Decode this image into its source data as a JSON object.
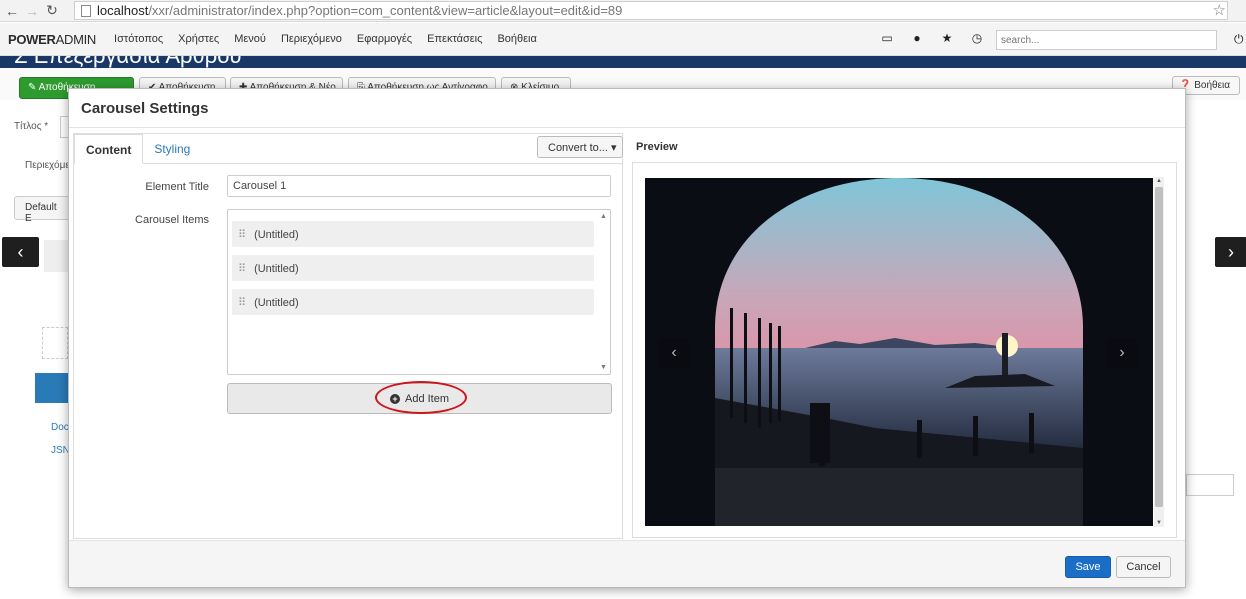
{
  "browser": {
    "url_host": "localhost",
    "url_path": "/xxr/administrator/index.php?option=com_content&view=article&layout=edit&id=89"
  },
  "topbar": {
    "brand_bold": "POWER",
    "brand_light": "ADMIN",
    "menu": [
      "Ιστότοπος",
      "Χρήστες",
      "Μενού",
      "Περιεχόμενο",
      "Εφαρμογές",
      "Επεκτάσεις",
      "Βοήθεια"
    ],
    "search_placeholder": "search..."
  },
  "page": {
    "title": "Σ Επεξεργασία Άρθρου",
    "toolbar": {
      "save": "Αποθήκευση",
      "save_close": "Αποθήκευση",
      "save_new": "Αποθήκευση & Νέο",
      "save_copy": "Αποθήκευση ως Αντίγραφο",
      "close": "Κλείσιμο",
      "help": "Βοήθεια"
    },
    "bg": {
      "title_label": "Τίτλος *",
      "content_tab": "Περιεχόμε",
      "default_editor": "Default E",
      "docs_link": "Doc",
      "json_link": "JSN"
    }
  },
  "modal": {
    "title": "Carousel Settings",
    "tabs": [
      "Content",
      "Styling"
    ],
    "convert_label": "Convert to...",
    "element_title_label": "Element Title",
    "element_title_value": "Carousel 1",
    "carousel_items_label": "Carousel Items",
    "items": [
      "(Untitled)",
      "(Untitled)",
      "(Untitled)"
    ],
    "add_item_label": "Add Item",
    "preview_label": "Preview",
    "save_label": "Save",
    "cancel_label": "Cancel"
  }
}
